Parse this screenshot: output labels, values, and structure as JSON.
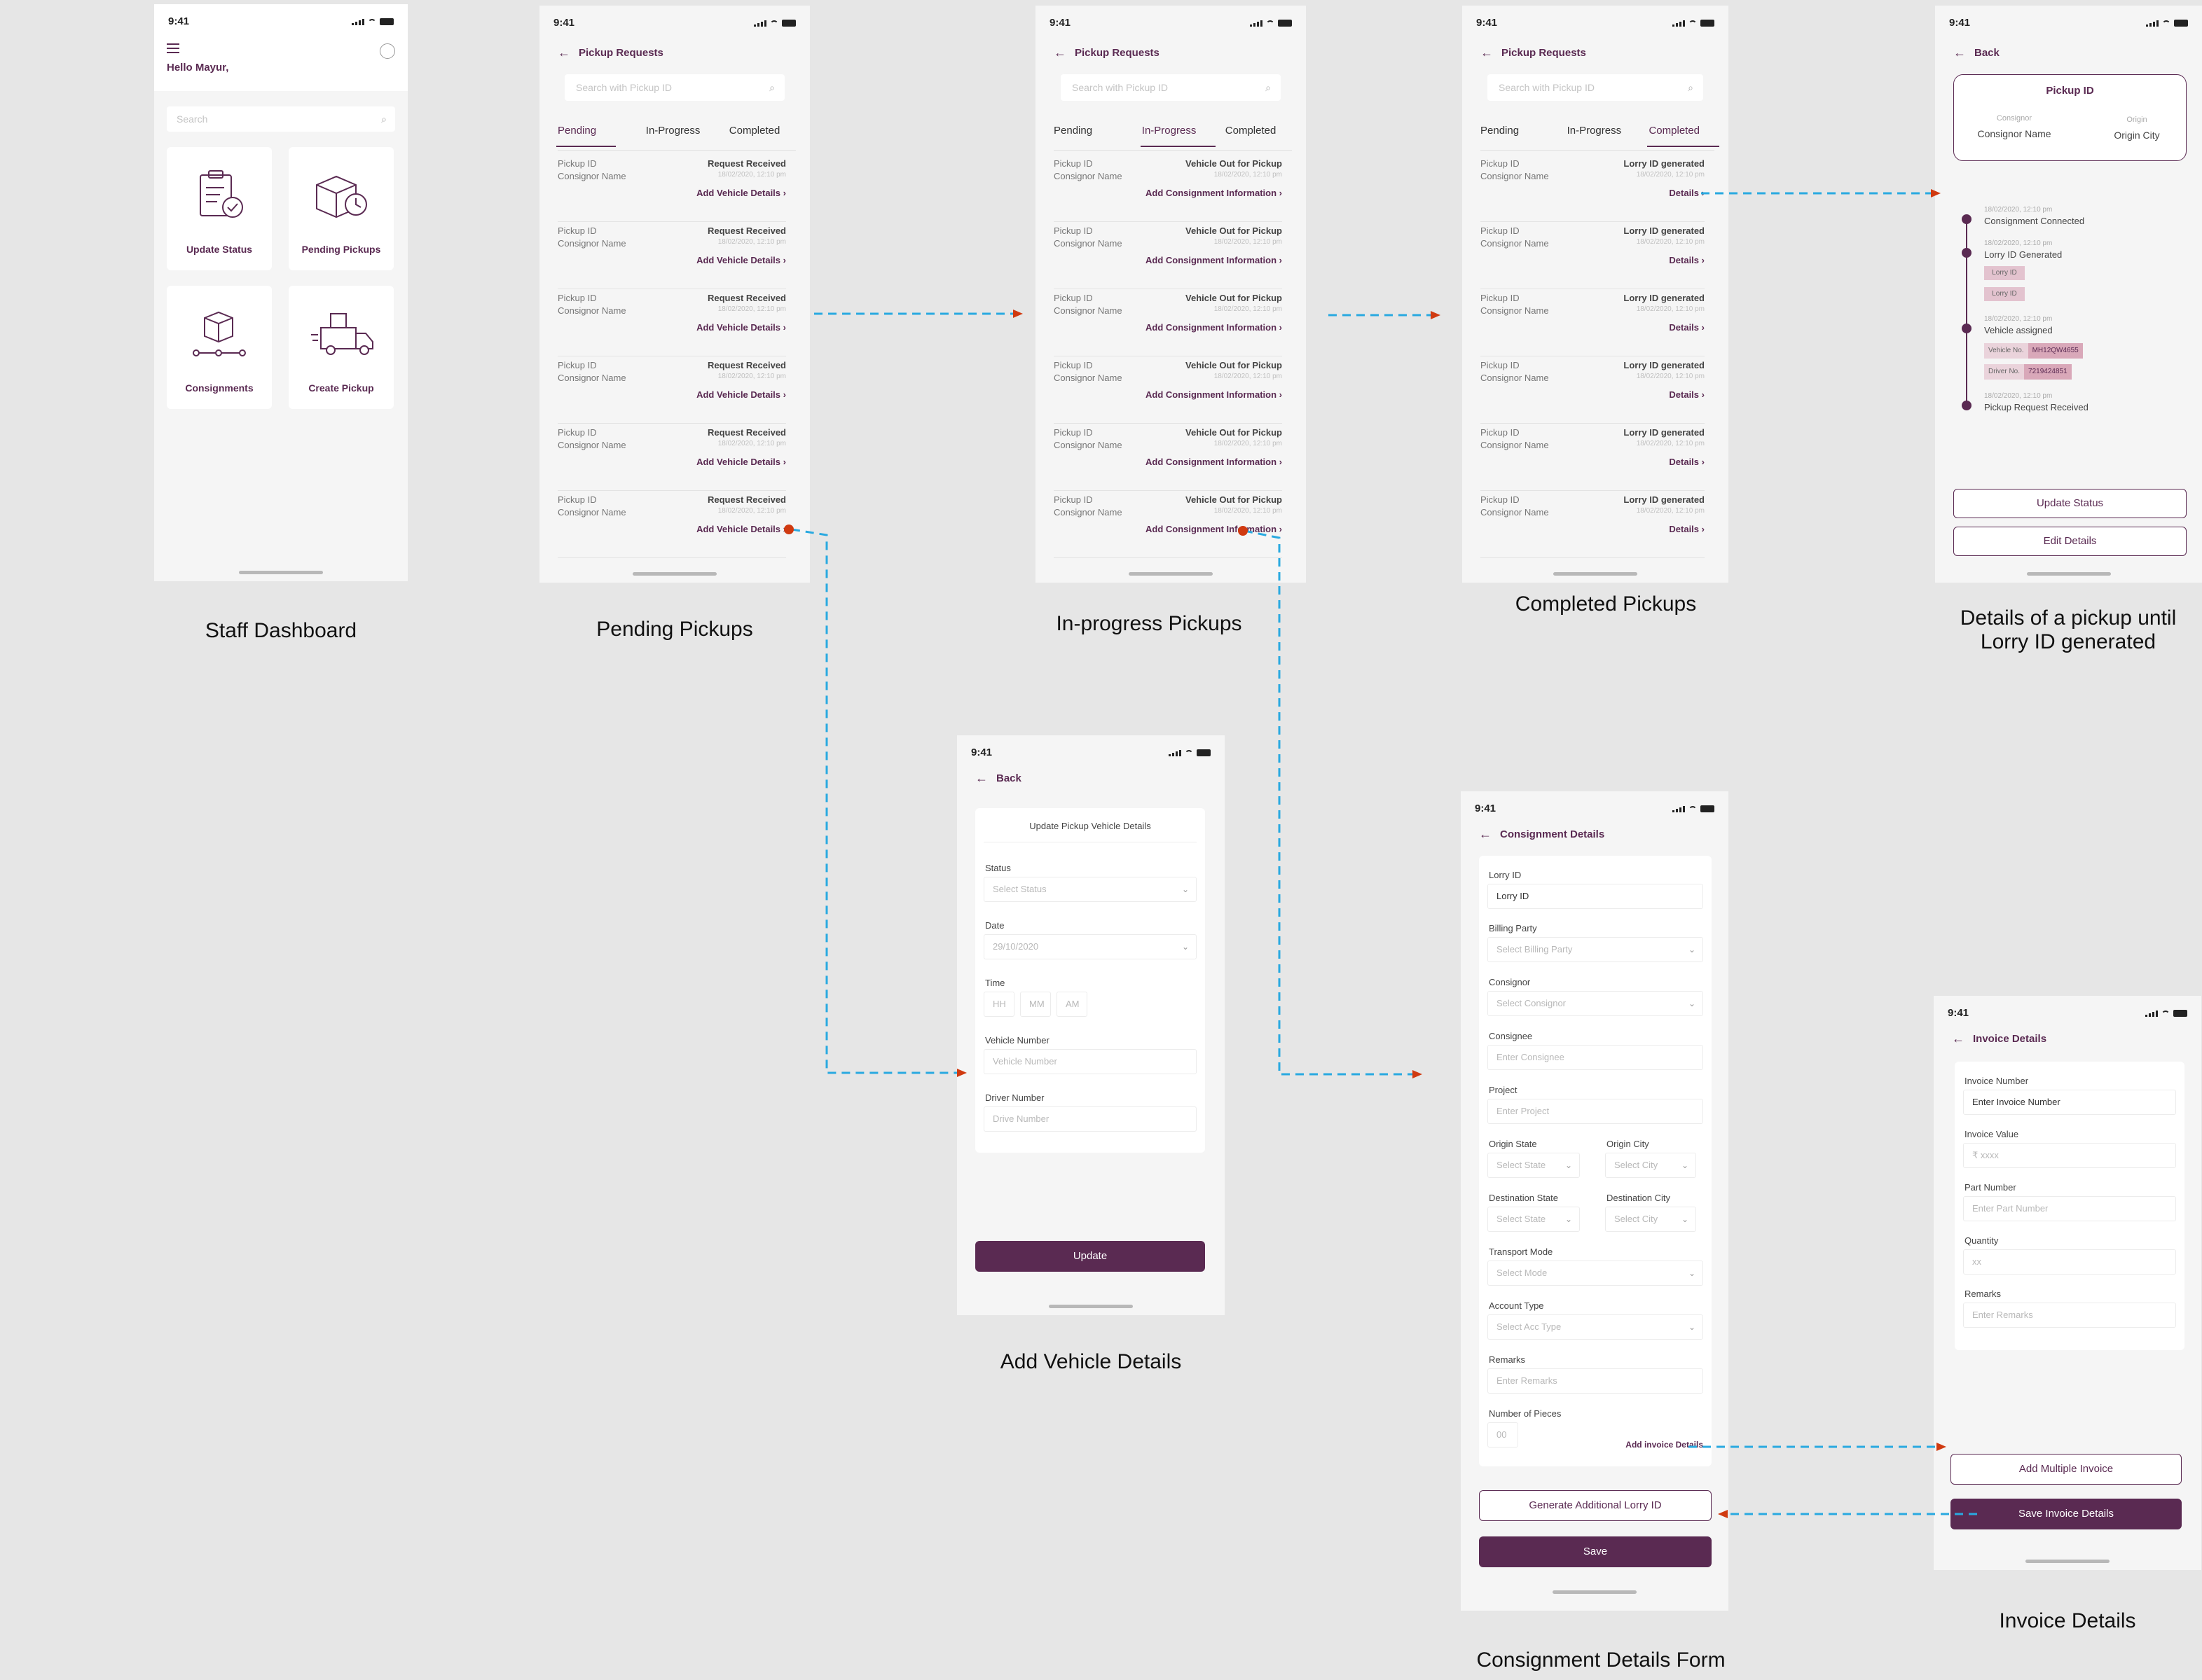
{
  "status_time": "9:41",
  "captions": {
    "dashboard": "Staff Dashboard",
    "pending": "Pending Pickups",
    "inprogress": "In-progress Pickups",
    "completed": "Completed Pickups",
    "details": "Details of a pickup until Lorry ID generated",
    "vehicle": "Add Vehicle Details",
    "consignment": "Consignment Details Form",
    "invoice": "Invoice Details"
  },
  "dashboard": {
    "greeting": "Hello Mayur,",
    "search_placeholder": "Search",
    "tiles": [
      {
        "label": "Update Status",
        "icon": "clipboard-check-icon"
      },
      {
        "label": "Pending Pickups",
        "icon": "box-clock-icon"
      },
      {
        "label": "Consignments",
        "icon": "box-route-icon"
      },
      {
        "label": "Create Pickup",
        "icon": "delivery-truck-icon"
      }
    ]
  },
  "pickup_requests": {
    "title": "Pickup Requests",
    "search_placeholder": "Search with Pickup ID",
    "tabs": [
      "Pending",
      "In-Progress",
      "Completed"
    ],
    "row_pickup_id": "Pickup ID",
    "row_consignor": "Consignor Name",
    "row_date": "18/02/2020, 12:10 pm",
    "pending": {
      "status": "Request Received",
      "action": "Add Vehicle Details"
    },
    "inprogress": {
      "status": "Vehicle Out for Pickup",
      "action": "Add Consignment Information"
    },
    "completed": {
      "status": "Lorry ID generated",
      "action": "Details"
    }
  },
  "pickup_details": {
    "back": "Back",
    "card_title": "Pickup ID",
    "consignor_label": "Consignor",
    "consignor_value": "Consignor Name",
    "origin_label": "Origin",
    "origin_value": "Origin City",
    "timeline": [
      {
        "date": "18/02/2020, 12:10 pm",
        "text": "Consignment Connected"
      },
      {
        "date": "18/02/2020, 12:10 pm",
        "text": "Lorry ID Generated",
        "chips": [
          "Lorry ID",
          "Lorry ID"
        ]
      },
      {
        "date": "18/02/2020, 12:10 pm",
        "text": "Vehicle assigned",
        "vehicle_label": "Vehicle No.",
        "vehicle_value": "MH12QW4655",
        "driver_label": "Driver No.",
        "driver_value": "7219424851"
      },
      {
        "date": "18/02/2020, 12:10 pm",
        "text": "Pickup Request Received"
      }
    ],
    "update_btn": "Update Status",
    "edit_btn": "Edit Details"
  },
  "vehicle_form": {
    "back": "Back",
    "card_title": "Update Pickup Vehicle Details",
    "status_label": "Status",
    "status_placeholder": "Select Status",
    "date_label": "Date",
    "date_value": "29/10/2020",
    "time_label": "Time",
    "time_parts": [
      "HH",
      "MM",
      "AM"
    ],
    "vehicle_label": "Vehicle Number",
    "vehicle_placeholder": "Vehicle Number",
    "driver_label": "Driver Number",
    "driver_placeholder": "Drive Number",
    "update_btn": "Update"
  },
  "consignment_form": {
    "title": "Consignment Details",
    "lorry_label": "Lorry ID",
    "lorry_value": "Lorry ID",
    "billing_label": "Billing Party",
    "billing_placeholder": "Select Billing Party",
    "consignor_label": "Consignor",
    "consignor_placeholder": "Select Consignor",
    "consignee_label": "Consignee",
    "consignee_placeholder": "Enter Consignee",
    "project_label": "Project",
    "project_placeholder": "Enter Project",
    "origin_state_label": "Origin State",
    "origin_city_label": "Origin City",
    "dest_state_label": "Destination State",
    "dest_city_label": "Destination City",
    "state_placeholder": "Select State",
    "city_placeholder": "Select City",
    "transport_label": "Transport Mode",
    "transport_placeholder": "Select Mode",
    "account_label": "Account Type",
    "account_placeholder": "Select Acc Type",
    "remarks_label": "Remarks",
    "remarks_placeholder": "Enter Remarks",
    "pieces_label": "Number of Pieces",
    "pieces_placeholder": "00",
    "invoice_link": "Add invoice Details",
    "generate_btn": "Generate Additional Lorry ID",
    "save_btn": "Save"
  },
  "invoice_form": {
    "title": "Invoice Details",
    "number_label": "Invoice Number",
    "number_value": "Enter Invoice Number",
    "value_label": "Invoice Value",
    "value_placeholder": "₹ xxxx",
    "part_label": "Part Number",
    "part_placeholder": "Enter Part Number",
    "qty_label": "Quantity",
    "qty_placeholder": "xx",
    "remarks_label": "Remarks",
    "remarks_placeholder": "Enter Remarks",
    "multi_btn": "Add Multiple Invoice",
    "save_btn": "Save Invoice Details"
  },
  "colors": {
    "brand": "#5a2a52",
    "flow_line": "#29a9e0",
    "flow_arrow": "#d03a10"
  }
}
